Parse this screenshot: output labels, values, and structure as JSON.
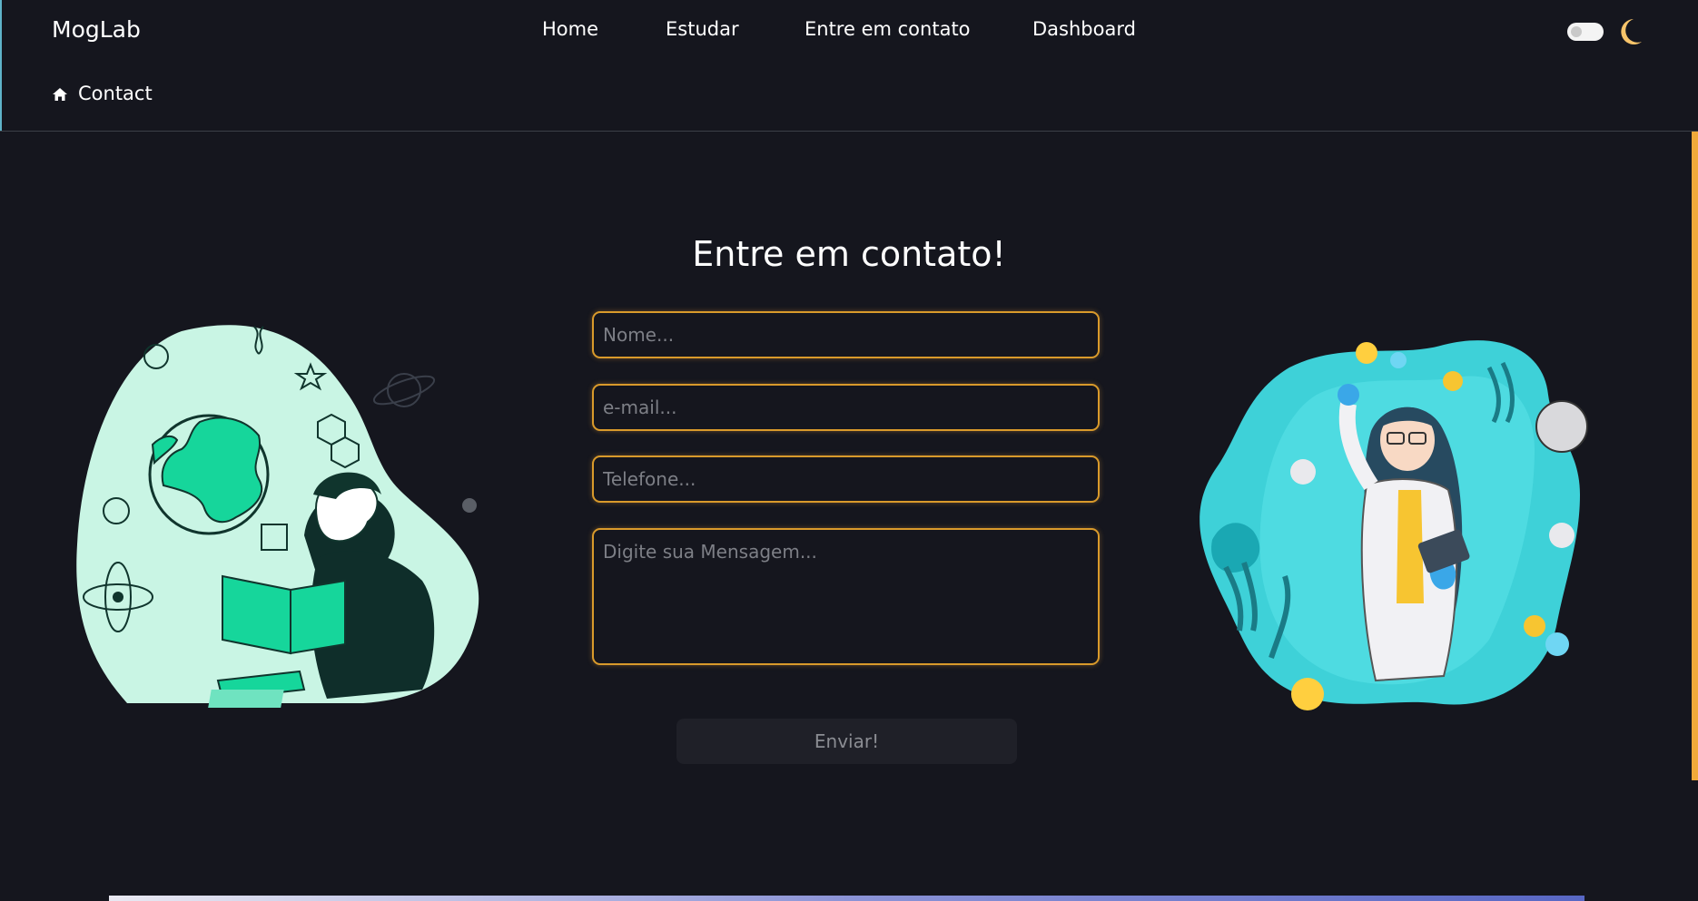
{
  "header": {
    "brand": "MogLab",
    "nav": [
      "Home",
      "Estudar",
      "Entre em contato",
      "Dashboard"
    ],
    "theme_toggle_icon": "moon-icon"
  },
  "breadcrumb": {
    "icon": "home-icon",
    "label": "Contact"
  },
  "form": {
    "title": "Entre em contato!",
    "name_placeholder": "Nome...",
    "email_placeholder": "e-mail...",
    "phone_placeholder": "Telefone...",
    "message_placeholder": "Digite sua Mensagem...",
    "submit_label": "Enviar!"
  },
  "colors": {
    "background": "#15161e",
    "accent": "#f0a93a",
    "mint": "#c9f5e4",
    "cyan": "#3ed1d8"
  }
}
